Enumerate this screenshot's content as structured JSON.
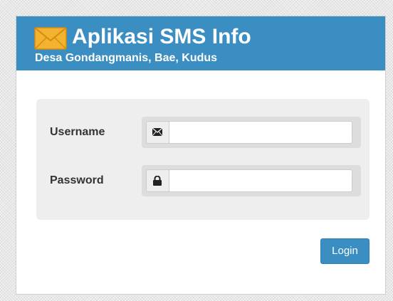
{
  "header": {
    "title": "Aplikasi SMS Info",
    "subtitle": "Desa Gondangmanis, Bae, Kudus",
    "logo_icon": "envelope-icon"
  },
  "form": {
    "username": {
      "label": "Username",
      "value": "",
      "icon": "envelope-icon"
    },
    "password": {
      "label": "Password",
      "value": "",
      "icon": "lock-icon"
    },
    "login_label": "Login"
  },
  "colors": {
    "brand": "#3b8ec2",
    "form_background": "#eeeeee",
    "label_text": "#333333",
    "logo": "#f4b32e"
  }
}
